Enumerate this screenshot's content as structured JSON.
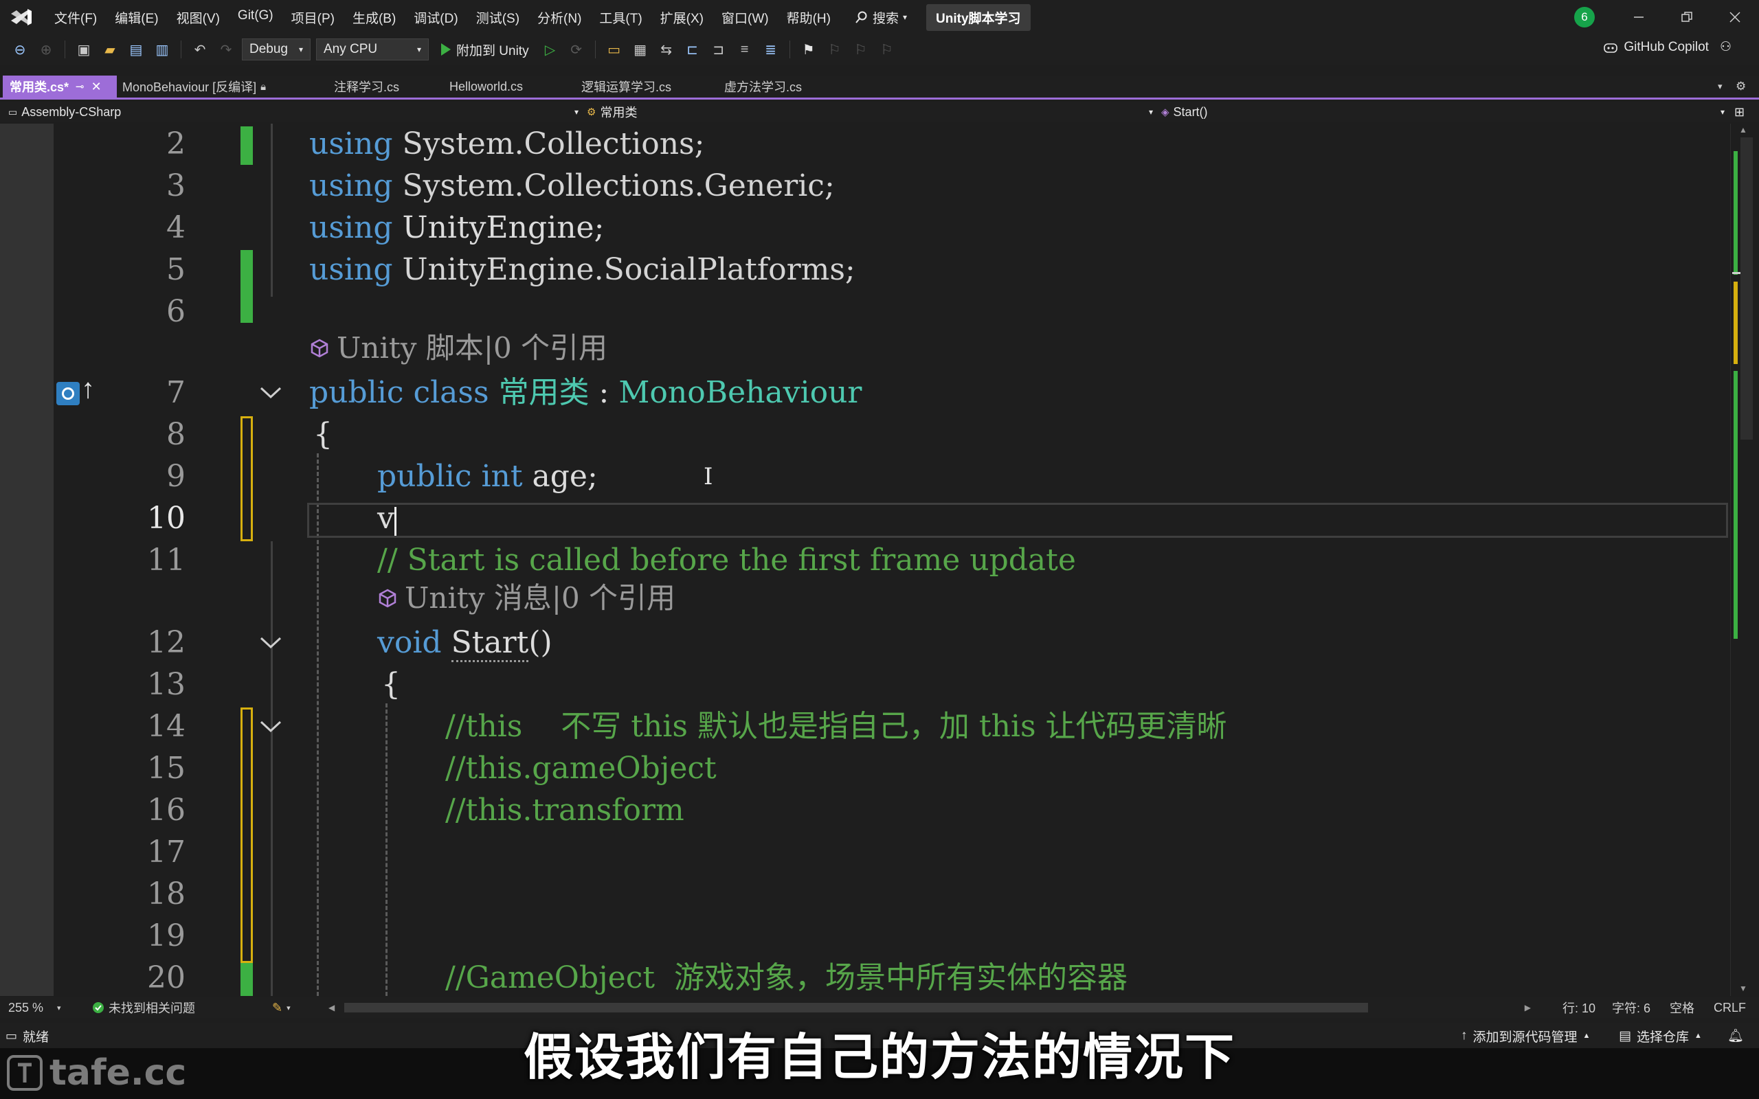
{
  "window": {
    "menu": [
      "文件(F)",
      "编辑(E)",
      "视图(V)",
      "Git(G)",
      "项目(P)",
      "生成(B)",
      "调试(D)",
      "测试(S)",
      "分析(N)",
      "工具(T)",
      "扩展(X)",
      "窗口(W)",
      "帮助(H)"
    ],
    "search_label": "搜索",
    "solution_name": "Unity脚本学习",
    "notification_count": "6"
  },
  "toolbar": {
    "config": "Debug",
    "platform": "Any CPU",
    "run_label": "附加到 Unity",
    "copilot_label": "GitHub Copilot"
  },
  "tabs": [
    {
      "label": "常用类.cs*",
      "active": true
    },
    {
      "label": "MonoBehaviour [反编译]",
      "active": false
    },
    {
      "label": "注释学习.cs",
      "active": false
    },
    {
      "label": "Helloworld.cs",
      "active": false
    },
    {
      "label": "逻辑运算学习.cs",
      "active": false
    },
    {
      "label": "虚方法学习.cs",
      "active": false
    }
  ],
  "navbar": {
    "project": "Assembly-CSharp",
    "type": "常用类",
    "member": "Start()"
  },
  "code": {
    "lines": [
      {
        "n": "2",
        "kw": "using",
        "rest": " System.Collections;"
      },
      {
        "n": "3",
        "kw": "using",
        "rest": " System.Collections.Generic;"
      },
      {
        "n": "4",
        "kw": "using",
        "rest": " UnityEngine;"
      },
      {
        "n": "5",
        "kw": "using",
        "rest": " UnityEngine.SocialPlatforms;"
      },
      {
        "n": "6"
      },
      {
        "n": "7",
        "kw": "public class",
        "type": "常用类",
        "sep": " : ",
        "base": "MonoBehaviour"
      },
      {
        "n": "8",
        "text": "{"
      },
      {
        "n": "9",
        "kw": "public int",
        "rest": " age;"
      },
      {
        "n": "10",
        "text": "v"
      },
      {
        "n": "11",
        "comment": "// Start is called before the first frame update"
      },
      {
        "n": "12",
        "kw": "void",
        "method": "Start",
        "rest": "()"
      },
      {
        "n": "13",
        "text": "{"
      },
      {
        "n": "14",
        "comment": "//this    不写 this 默认也是指自己，加 this 让代码更清晰"
      },
      {
        "n": "15",
        "comment": "//this.gameObject"
      },
      {
        "n": "16",
        "comment": "//this.transform"
      },
      {
        "n": "17"
      },
      {
        "n": "18"
      },
      {
        "n": "19"
      },
      {
        "n": "20",
        "comment": "//GameObject  游戏对象，场景中所有实体的容器"
      }
    ],
    "codelens_class": "Unity 脚本|0 个引用",
    "codelens_method": "Unity 消息|0 个引用"
  },
  "editor_footer": {
    "zoom": "255 %",
    "issues": "未找到相关问题",
    "line": "行: 10",
    "col": "字符: 6",
    "indent": "空格",
    "eol": "CRLF"
  },
  "status": {
    "ready": "就绪",
    "source_control": "添加到源代码管理",
    "repo": "选择仓库"
  },
  "subtitle": "假设我们有自己的方法的情况下",
  "watermark": "tafe.cc",
  "colors": {
    "accent": "#9d6dd8",
    "keyword": "#569cd6",
    "type": "#4ec9b0",
    "comment": "#57a64a",
    "saved_change": "#3cb043",
    "unsaved_change": "#d7b00f"
  }
}
